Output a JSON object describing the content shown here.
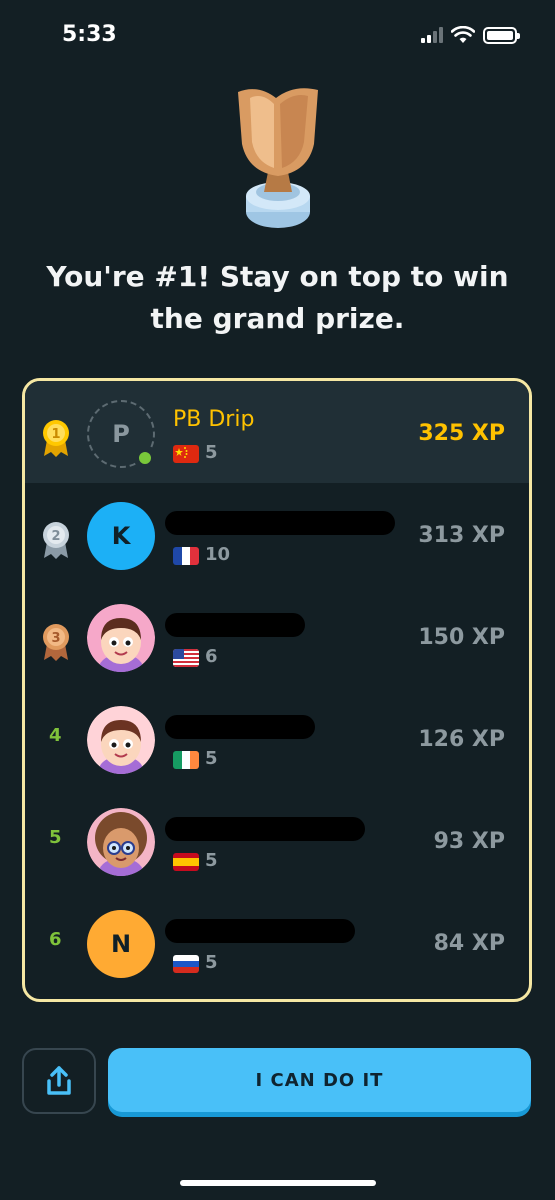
{
  "status_bar": {
    "time": "5:33",
    "icons": [
      "cellular-signal-icon",
      "wifi-icon",
      "battery-icon"
    ]
  },
  "trophy": {
    "icon": "bronze-trophy-icon"
  },
  "headline": "You're #1! Stay on top to win the grand prize.",
  "leaderboard": [
    {
      "rank": "1",
      "medal": "gold",
      "avatar_letter": "P",
      "name": "PB Drip",
      "flag": "china",
      "streak": "5",
      "xp": "325 XP",
      "is_you": true,
      "online": true
    },
    {
      "rank": "2",
      "medal": "silver",
      "avatar_letter": "K",
      "name": "",
      "flag": "france",
      "streak": "10",
      "xp": "313 XP"
    },
    {
      "rank": "3",
      "medal": "bronze",
      "avatar_letter": "",
      "name": "",
      "flag": "usa",
      "streak": "6",
      "xp": "150 XP"
    },
    {
      "rank": "4",
      "avatar_letter": "",
      "name": "",
      "flag": "ireland",
      "streak": "5",
      "xp": "126 XP"
    },
    {
      "rank": "5",
      "avatar_letter": "",
      "name": "",
      "flag": "spain",
      "streak": "5",
      "xp": "93 XP"
    },
    {
      "rank": "6",
      "avatar_letter": "N",
      "name": "",
      "flag": "russia",
      "streak": "5",
      "xp": "84 XP"
    }
  ],
  "buttons": {
    "share_icon": "share-icon",
    "cta_label": "I CAN DO IT"
  },
  "colors": {
    "background": "#131f24",
    "gold": "#ffc200",
    "accent_blue": "#49c0f8",
    "card_border": "#f5e7a3"
  }
}
